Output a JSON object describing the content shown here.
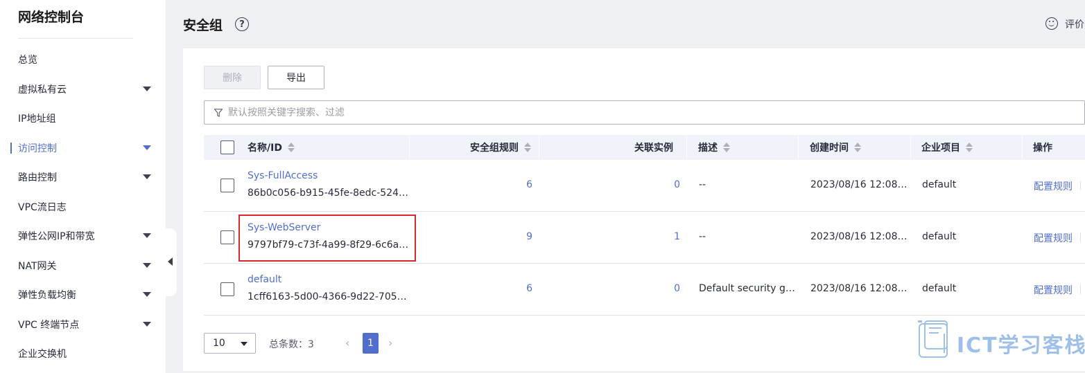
{
  "sidebar": {
    "title": "网络控制台",
    "items": [
      {
        "label": "总览",
        "has_caret": false,
        "active": false
      },
      {
        "label": "虚拟私有云",
        "has_caret": true,
        "active": false
      },
      {
        "label": "IP地址组",
        "has_caret": false,
        "active": false
      },
      {
        "label": "访问控制",
        "has_caret": true,
        "active": true
      },
      {
        "label": "路由控制",
        "has_caret": true,
        "active": false
      },
      {
        "label": "VPC流日志",
        "has_caret": false,
        "active": false
      },
      {
        "label": "弹性公网IP和带宽",
        "has_caret": true,
        "active": false
      },
      {
        "label": "NAT网关",
        "has_caret": true,
        "active": false
      },
      {
        "label": "弹性负载均衡",
        "has_caret": true,
        "active": false
      },
      {
        "label": "VPC 终端节点",
        "has_caret": true,
        "active": false
      },
      {
        "label": "企业交换机",
        "has_caret": false,
        "active": false
      }
    ]
  },
  "header": {
    "title": "安全组",
    "help_glyph": "?",
    "rate_label": "评价"
  },
  "toolbar": {
    "delete_label": "删除",
    "export_label": "导出"
  },
  "search": {
    "placeholder": "默认按照关键字搜索、过滤",
    "value": ""
  },
  "table": {
    "columns": [
      "名称/ID",
      "安全组规则",
      "关联实例",
      "描述",
      "创建时间",
      "企业项目",
      "操作"
    ],
    "rows": [
      {
        "name": "Sys-FullAccess",
        "id": "86b0c056-b915-45fe-8edc-524…",
        "rules": "6",
        "instances": "0",
        "description": "--",
        "created": "2023/08/16 12:08…",
        "project": "default",
        "action": "配置规则"
      },
      {
        "name": "Sys-WebServer",
        "id": "9797bf79-c73f-4a99-8f29-6c6a…",
        "rules": "9",
        "instances": "1",
        "description": "--",
        "created": "2023/08/16 12:08…",
        "project": "default",
        "action": "配置规则"
      },
      {
        "name": "default",
        "id": "1cff6163-5d00-4366-9d22-705…",
        "rules": "6",
        "instances": "0",
        "description": "Default security g…",
        "created": "2023/08/16 12:08…",
        "project": "default",
        "action": "配置规则"
      }
    ]
  },
  "pagination": {
    "page_size": "10",
    "total_label": "总条数：3",
    "current_page": "1",
    "prev_glyph": "‹",
    "next_glyph": "›"
  },
  "watermark": {
    "text": "ICT学习客栈"
  },
  "colors": {
    "accent": "#526ecc",
    "highlight": "#d9272e"
  }
}
